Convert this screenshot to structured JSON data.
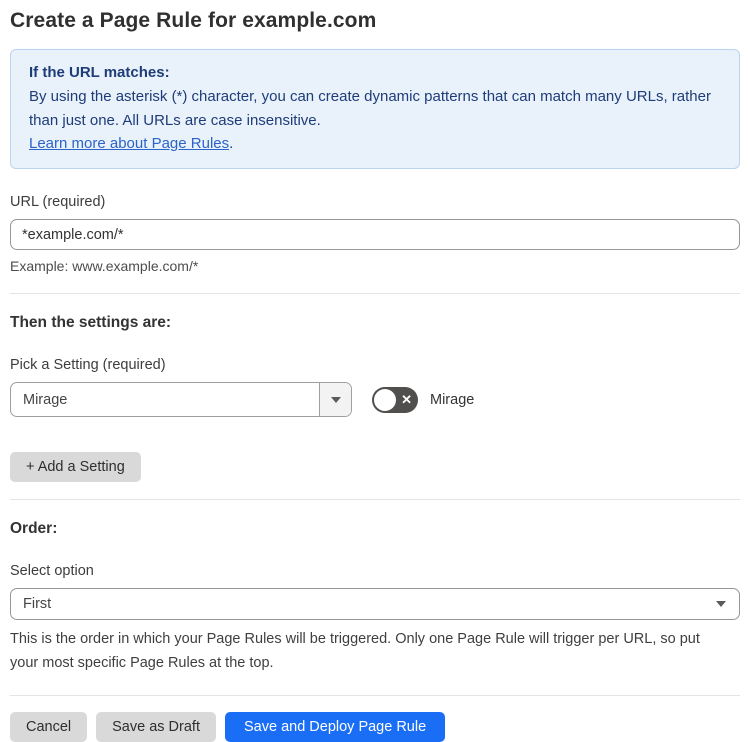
{
  "page": {
    "title": "Create a Page Rule for example.com"
  },
  "info_box": {
    "heading": "If the URL matches:",
    "body": "By using the asterisk (*) character, you can create dynamic patterns that can match many URLs, rather than just one. All URLs are case insensitive.",
    "link_text": "Learn more about Page Rules",
    "link_suffix": "."
  },
  "url_field": {
    "label": "URL (required)",
    "value": "*example.com/*",
    "hint": "Example: www.example.com/*"
  },
  "settings_section": {
    "heading": "Then the settings are:",
    "picker_label": "Pick a Setting (required)",
    "picker_value": "Mirage",
    "toggle": {
      "state": "off",
      "icon": "✕",
      "label": "Mirage"
    },
    "add_button_label": "+ Add a Setting"
  },
  "order_section": {
    "heading": "Order:",
    "select_label": "Select option",
    "select_value": "First",
    "help_text": "This is the order in which your Page Rules will be triggered. Only one Page Rule will trigger per URL, so put your most specific Page Rules at the top."
  },
  "footer": {
    "cancel_label": "Cancel",
    "save_draft_label": "Save as Draft",
    "save_deploy_label": "Save and Deploy Page Rule"
  },
  "colors": {
    "accent_blue": "#1a6ef5",
    "info_bg": "#e9f2fb",
    "info_border": "#b9d4ee",
    "info_text": "#1e3c78",
    "link_blue": "#2b63c9",
    "toggle_off_bg": "#504f4d",
    "gray_button_bg": "#d9d9d9"
  }
}
